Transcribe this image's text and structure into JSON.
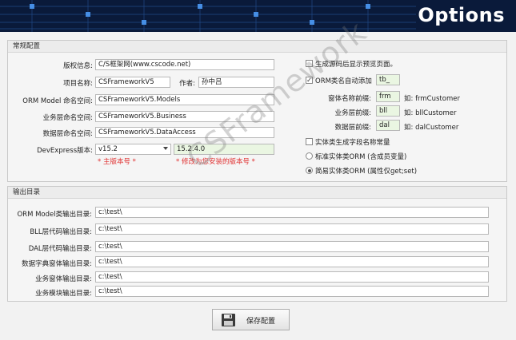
{
  "window": {
    "title": "Options"
  },
  "general": {
    "title": "常规配置",
    "copyright_label": "版权信息:",
    "copyright_value": "C/S框架网(www.cscode.net)",
    "project_label": "项目名称:",
    "project_value": "CSFrameworkV5",
    "author_label": "作者:",
    "author_value": "孙中吕",
    "orm_ns_label": "ORM Model 命名空间:",
    "orm_ns_value": "CSFrameworkV5.Models",
    "biz_ns_label": "业务层命名空间:",
    "biz_ns_value": "CSFrameworkV5.Business",
    "data_ns_label": "数据层命名空间:",
    "data_ns_value": "CSFrameworkV5.DataAccess",
    "devexpress_label": "DevExpress版本:",
    "devexpress_main": "v15.2",
    "devexpress_full": "15.2.4.0",
    "main_version_note": "* 主版本号 *",
    "installed_version_note": "* 修改为您安装的版本号 *",
    "preview_after_gen_label": "生成源码后显示预览页面。",
    "preview_after_gen_checked": false,
    "orm_prefix_label": "ORM类名自动添加",
    "orm_prefix_checked": true,
    "orm_prefix_value": "tb_",
    "form_prefix_label": "窗体名称前缀:",
    "form_prefix_value": "frm",
    "form_prefix_example": "如: frmCustomer",
    "biz_prefix_label": "业务层前缀:",
    "biz_prefix_value": "bll",
    "biz_prefix_example": "如: bllCustomer",
    "data_prefix_label": "数据层前缀:",
    "data_prefix_value": "dal",
    "data_prefix_example": "如: dalCustomer",
    "entity_const_label": "实体类生成字段名称常量",
    "entity_const_checked": false,
    "orm_standard_label": "标准实体类ORM (含成员变量)",
    "orm_standard_selected": false,
    "orm_simple_label": "简易实体类ORM (属性仅get;set)",
    "orm_simple_selected": true
  },
  "output": {
    "title": "输出目录",
    "rows": [
      {
        "label": "ORM Model类输出目录:",
        "value": "c:\\test\\"
      },
      {
        "label": "BLL层代码输出目录:",
        "value": "c:\\test\\"
      },
      {
        "label": "DAL层代码输出目录:",
        "value": "c:\\test\\"
      },
      {
        "label": "数据字典窗体输出目录:",
        "value": "c:\\test\\"
      },
      {
        "label": "业务窗体输出目录:",
        "value": "c:\\test\\"
      },
      {
        "label": "业务模块输出目录:",
        "value": "c:\\test\\"
      }
    ]
  },
  "save_button_label": "保存配置",
  "watermark": "CSFramework",
  "colors": {
    "header_bg": "#0a1a3a",
    "accent_red": "#e03030",
    "highlight_input": "#eaf6e2"
  }
}
